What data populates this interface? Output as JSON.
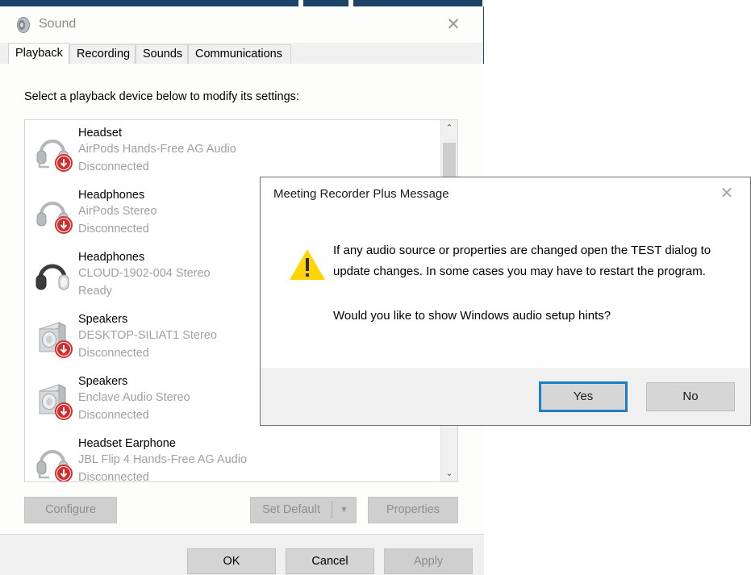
{
  "background": {
    "strip_color": "#1d4268"
  },
  "sound_window": {
    "title": "Sound",
    "title_icon": "speaker-icon",
    "close_label": "✕",
    "tabs": [
      {
        "label": "Playback",
        "active": true
      },
      {
        "label": "Recording",
        "active": false
      },
      {
        "label": "Sounds",
        "active": false
      },
      {
        "label": "Communications",
        "active": false
      }
    ],
    "instruction": "Select a playback device below to modify its settings:",
    "devices": [
      {
        "icon": "headset-disconnected-icon",
        "name": "Headset",
        "sub": "AirPods Hands-Free AG Audio",
        "state": "Disconnected"
      },
      {
        "icon": "headphones-disconnected-icon",
        "name": "Headphones",
        "sub": "AirPods Stereo",
        "state": "Disconnected"
      },
      {
        "icon": "headphones-ready-icon",
        "name": "Headphones",
        "sub": "CLOUD-1902-004 Stereo",
        "state": "Ready"
      },
      {
        "icon": "speakers-disconnected-icon",
        "name": "Speakers",
        "sub": "DESKTOP-SILIAT1 Stereo",
        "state": "Disconnected"
      },
      {
        "icon": "speakers-disconnected-icon",
        "name": "Speakers",
        "sub": "Enclave Audio Stereo",
        "state": "Disconnected"
      },
      {
        "icon": "headset-disconnected-icon",
        "name": "Headset Earphone",
        "sub": "JBL Flip 4 Hands-Free AG Audio",
        "state": "Disconnected"
      }
    ],
    "scrollbar": {
      "up_arrow": "⌃",
      "down_arrow": "⌄"
    },
    "buttons": {
      "configure": {
        "label": "Configure",
        "enabled": false
      },
      "set_default": {
        "label": "Set Default",
        "enabled": false,
        "caret": "▼"
      },
      "properties": {
        "label": "Properties",
        "enabled": false
      },
      "ok": {
        "label": "OK",
        "enabled": true
      },
      "cancel": {
        "label": "Cancel",
        "enabled": true
      },
      "apply": {
        "label": "Apply",
        "enabled": false
      }
    }
  },
  "message_dialog": {
    "title": "Meeting Recorder Plus Message",
    "close_label": "✕",
    "warning_icon": "warning-triangle-icon",
    "warning_color": "#fcd503",
    "paragraph_1": "If any audio source or properties are changed open the TEST dialog to update changes. In some cases you may have to restart the program.",
    "paragraph_2": "Would you like to show Windows audio setup hints?",
    "buttons": {
      "yes": {
        "label": "Yes",
        "focused": true,
        "focus_color": "#1f7ec2"
      },
      "no": {
        "label": "No",
        "focused": false
      }
    }
  }
}
